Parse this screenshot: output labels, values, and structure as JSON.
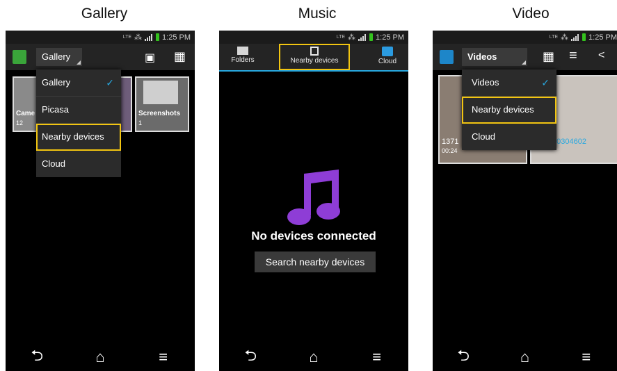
{
  "captions": {
    "gallery": "Gallery",
    "music": "Music",
    "video": "Video"
  },
  "status": {
    "network": "LTE",
    "time": "1:25 PM"
  },
  "gallery": {
    "dropdown_label": "Gallery",
    "menu": [
      "Gallery",
      "Picasa",
      "Nearby devices",
      "Cloud"
    ],
    "albums": [
      {
        "label": "Came",
        "count": "12"
      },
      {
        "label": "Screenshots",
        "count": "1"
      }
    ]
  },
  "music": {
    "tabs": [
      "Folders",
      "Nearby devices",
      "Cloud"
    ],
    "empty_title": "No devices connected",
    "search_button": "Search nearby devices"
  },
  "video": {
    "dropdown_label": "Videos",
    "menu": [
      "Videos",
      "Nearby devices",
      "Cloud"
    ],
    "thumbs": [
      {
        "title": "1371",
        "duration": "00:24"
      },
      {
        "title": "20304602"
      }
    ]
  },
  "icons": {
    "check": "✓",
    "back": "⮌",
    "home": "⌂",
    "menu": "≡"
  },
  "colors": {
    "highlight": "#f2c511",
    "accent": "#28a8e0",
    "music_note": "#8e3dd6"
  }
}
